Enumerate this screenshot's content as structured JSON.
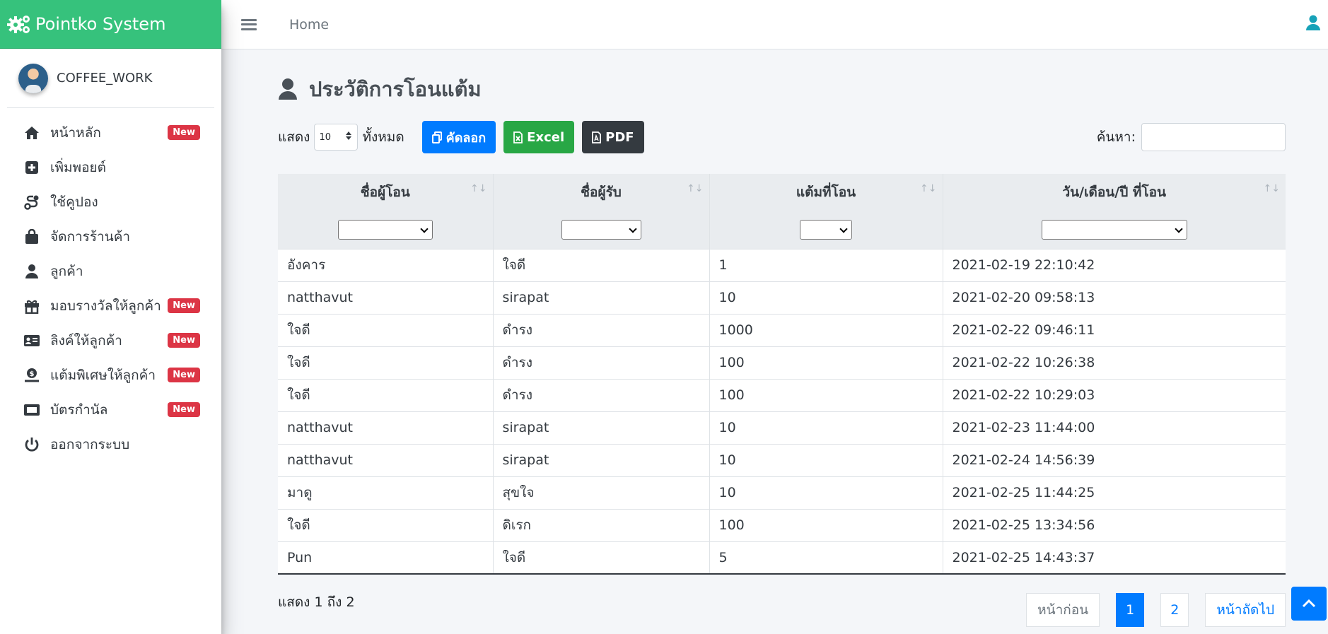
{
  "brand": {
    "title": "Pointko System",
    "icon": "gears-icon",
    "color": "#36c27c"
  },
  "user": {
    "name": "COFFEE_WORK"
  },
  "sidebar": {
    "items": [
      {
        "label": "หน้าหลัก",
        "icon": "home-icon",
        "badge": "New"
      },
      {
        "label": "เพิ่มพอยต์",
        "icon": "plus-square-icon",
        "badge": ""
      },
      {
        "label": "ใช้คูปอง",
        "icon": "route-icon",
        "badge": ""
      },
      {
        "label": "จัดการร้านค้า",
        "icon": "shopping-bag-icon",
        "badge": ""
      },
      {
        "label": "ลูกค้า",
        "icon": "user-icon",
        "badge": ""
      },
      {
        "label": "มอบรางวัลให้ลูกค้า",
        "icon": "gift-icon",
        "badge": "New"
      },
      {
        "label": "ลิงค์ให้ลูกค้า",
        "icon": "id-card-icon",
        "badge": "New"
      },
      {
        "label": "แต้มพิเศษให้ลูกค้า",
        "icon": "hand-coin-icon",
        "badge": "New"
      },
      {
        "label": "บัตรกำนัล",
        "icon": "ticket-icon",
        "badge": "New"
      },
      {
        "label": "ออกจากระบบ",
        "icon": "power-icon",
        "badge": ""
      }
    ]
  },
  "header": {
    "home": "Home"
  },
  "page": {
    "title": "ประวัติการโอนแต้ม"
  },
  "toolbar": {
    "show_label": "แสดง",
    "length_value": "10",
    "all_label": "ทั้งหมด",
    "copy_label": "คัดลอก",
    "excel_label": "Excel",
    "pdf_label": "PDF",
    "search_label": "ค้นหา:",
    "search_value": ""
  },
  "table": {
    "columns": [
      "ชื่อผู้โอน",
      "ชื่อผู้รับ",
      "แต้มที่โอน",
      "วัน/เดือน/ปี ที่โอน"
    ],
    "rows": [
      [
        "อังคาร",
        "ใจดี",
        "1",
        "2021-02-19 22:10:42"
      ],
      [
        "natthavut",
        "sirapat",
        "10",
        "2021-02-20 09:58:13"
      ],
      [
        "ใจดี",
        "ดำรง",
        "1000",
        "2021-02-22 09:46:11"
      ],
      [
        "ใจดี",
        "ดำรง",
        "100",
        "2021-02-22 10:26:38"
      ],
      [
        "ใจดี",
        "ดำรง",
        "100",
        "2021-02-22 10:29:03"
      ],
      [
        "natthavut",
        "sirapat",
        "10",
        "2021-02-23 11:44:00"
      ],
      [
        "natthavut",
        "sirapat",
        "10",
        "2021-02-24 14:56:39"
      ],
      [
        "มาดู",
        "สุขใจ",
        "10",
        "2021-02-25 11:44:25"
      ],
      [
        "ใจดี",
        "ดิเรก",
        "100",
        "2021-02-25 13:34:56"
      ],
      [
        "Pun",
        "ใจดี",
        "5",
        "2021-02-25 14:43:37"
      ]
    ]
  },
  "footer": {
    "info": "แสดง 1 ถึง 2",
    "prev": "หน้าก่อน",
    "pages": [
      "1",
      "2"
    ],
    "current_page": "1",
    "next": "หน้าถัดไป"
  }
}
